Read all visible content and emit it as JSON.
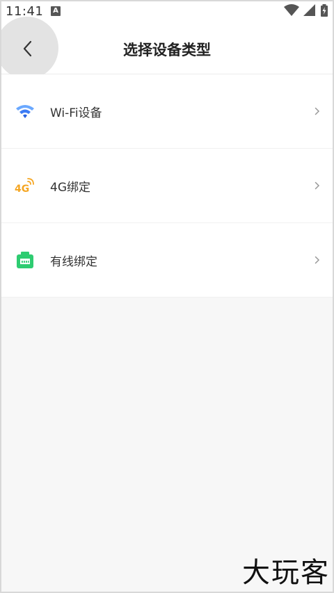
{
  "status_bar": {
    "time": "11:41",
    "notification_letter": "A"
  },
  "header": {
    "title": "选择设备类型",
    "back_icon": "back-arrow-icon"
  },
  "device_types": [
    {
      "label": "Wi-Fi设备",
      "icon": "wifi-icon",
      "color": "#3d7cf5"
    },
    {
      "label": "4G绑定",
      "icon": "4g-icon",
      "color": "#f5a623"
    },
    {
      "label": "有线绑定",
      "icon": "ethernet-icon",
      "color": "#2ecc71"
    }
  ],
  "watermark": "大玩客"
}
